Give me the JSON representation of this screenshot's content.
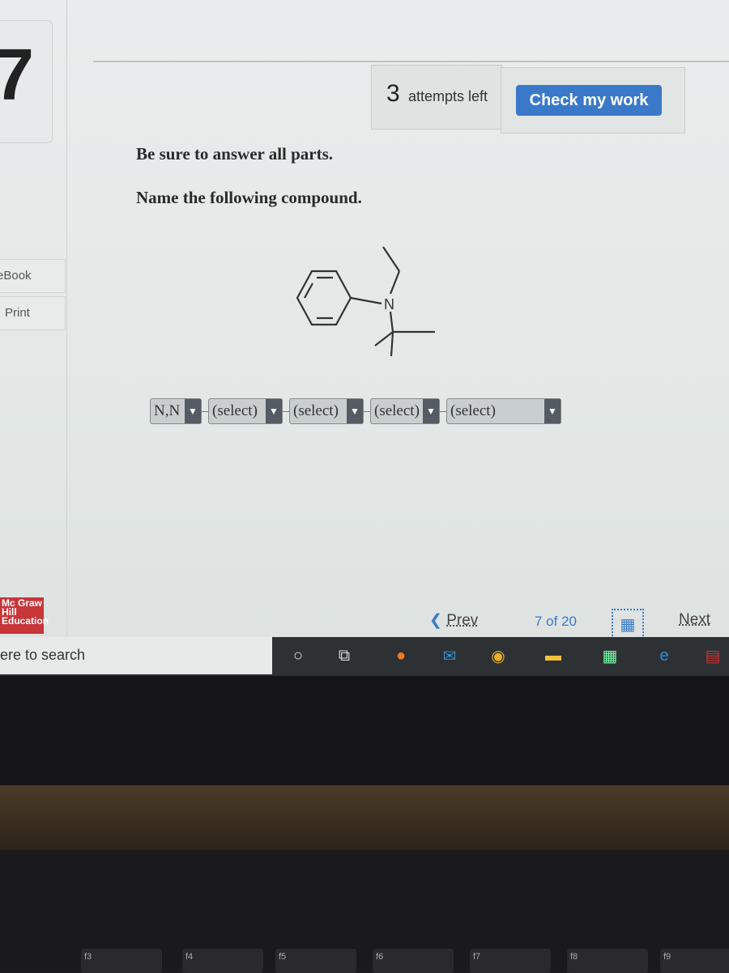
{
  "sidebar": {
    "question_number": "7",
    "ebook_label": "eBook",
    "print_label": "Print",
    "logo_text": "Mc Graw Hill Education"
  },
  "header": {
    "attempts_count": "3",
    "attempts_label": "attempts left",
    "check_label": "Check my work"
  },
  "question": {
    "instruction": "Be sure to answer all parts.",
    "prompt": "Name the following compound.",
    "atom_label": "N"
  },
  "answer": {
    "selects": [
      {
        "value": "N,N"
      },
      {
        "value": "(select)"
      },
      {
        "value": "(select)"
      },
      {
        "value": "(select)"
      },
      {
        "value": "(select)"
      }
    ]
  },
  "footer": {
    "prev_label": "Prev",
    "position": "7 of 20",
    "next_label": "Next"
  },
  "taskbar": {
    "search_placeholder": "ere to search",
    "icons": [
      "cortana-icon",
      "task-view-icon",
      "firefox-icon",
      "mail-icon",
      "chrome-icon",
      "file-explorer-icon",
      "calculator-icon",
      "internet-explorer-icon",
      "winrar-icon"
    ]
  },
  "keyboard": {
    "keys": [
      "f3",
      "f4",
      "f5",
      "f6",
      "f7",
      "f8",
      "f9"
    ]
  },
  "colors": {
    "accent": "#3a79c9",
    "logo": "#c8363a"
  }
}
